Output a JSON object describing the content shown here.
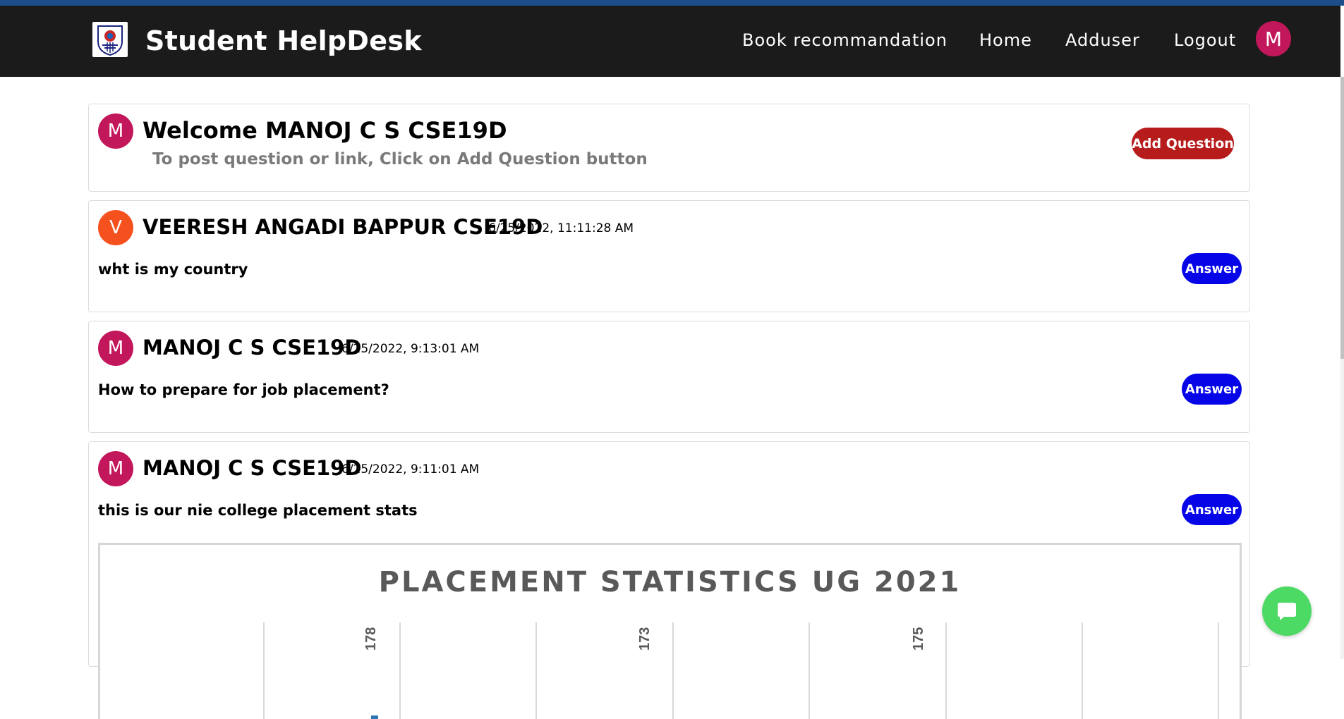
{
  "brand": {
    "title": "Student HelpDesk"
  },
  "nav": {
    "book": "Book recommandation",
    "home": "Home",
    "adduser": "Adduser",
    "logout": "Logout",
    "avatar_letter": "M"
  },
  "welcome": {
    "avatar_letter": "M",
    "title": "Welcome MANOJ C S CSE19D",
    "subtitle": "To post question or link, Click on Add Question button",
    "add_button": "Add Question"
  },
  "questions": [
    {
      "avatar_letter": "V",
      "avatar_color": "#f4511e",
      "author": "VEERESH ANGADI BAPPUR CSE19D",
      "time": "6/25/2022, 11:11:28 AM",
      "text": "wht is my country",
      "answer_label": "Answer"
    },
    {
      "avatar_letter": "M",
      "avatar_color": "#c2185b",
      "author": "MANOJ C S CSE19D",
      "time": "6/25/2022, 9:13:01 AM",
      "text": "How to prepare for job placement?",
      "answer_label": "Answer"
    },
    {
      "avatar_letter": "M",
      "avatar_color": "#c2185b",
      "author": "MANOJ C S CSE19D",
      "time": "6/25/2022, 9:11:01 AM",
      "text": "this is our nie college placement stats",
      "answer_label": "Answer"
    }
  ],
  "colors": {
    "navbar": "#1b1b1b",
    "add_button": "#b71c1c",
    "answer_button": "#0505e8",
    "chat_button": "#4cd964"
  },
  "chart_data": {
    "type": "bar",
    "title": "PLACEMENT STATISTICS UG 2021",
    "data_labels": [
      "178",
      "173",
      "175"
    ]
  }
}
